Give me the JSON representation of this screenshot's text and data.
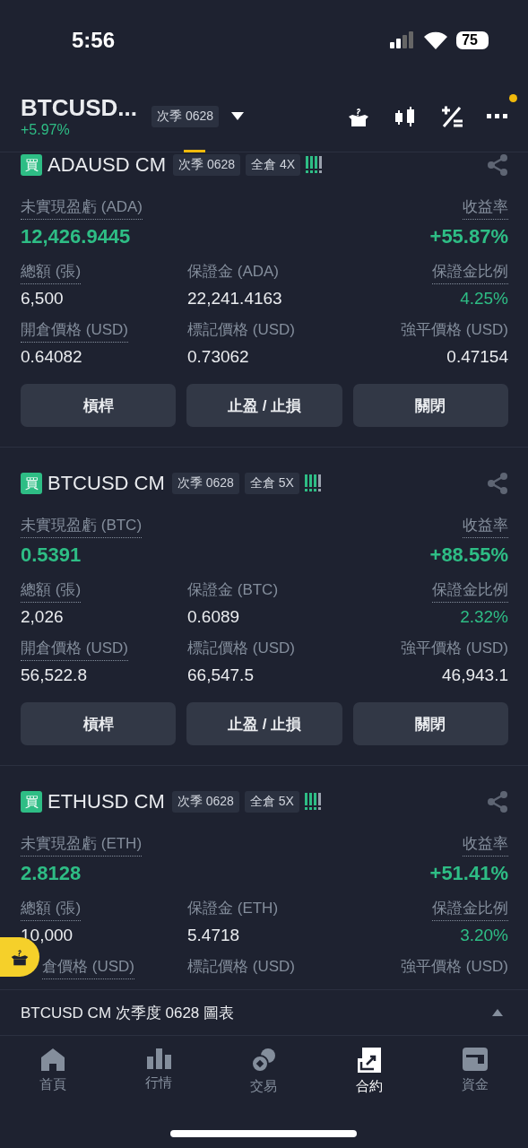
{
  "status_bar": {
    "time": "5:56",
    "battery": "75"
  },
  "header": {
    "symbol": "BTCUSD...",
    "change": "+5.97%",
    "contract": "次季 0628",
    "has_notification": true
  },
  "positions": [
    {
      "side": "買",
      "symbol": "ADAUSD CM",
      "contract": "次季 0628",
      "margin_mode": "全倉 4X",
      "pnl_label": "未實現盈虧 (ADA)",
      "pnl_value": "12,426.9445",
      "roe_label": "收益率",
      "roe_value": "+55.87%",
      "stats": [
        {
          "label": "總額 (張)",
          "value": "6,500",
          "underlined": true,
          "highlighted": false
        },
        {
          "label": "保證金 (ADA)",
          "value": "22,241.4163",
          "underlined": false,
          "highlighted": false
        },
        {
          "label": "保證金比例",
          "value": "4.25%",
          "underlined": true,
          "highlighted": true
        },
        {
          "label": "開倉價格 (USD)",
          "value": "0.64082",
          "underlined": true,
          "highlighted": false
        },
        {
          "label": "標記價格 (USD)",
          "value": "0.73062",
          "underlined": false,
          "highlighted": false
        },
        {
          "label": "強平價格 (USD)",
          "value": "0.47154",
          "underlined": false,
          "highlighted": false
        }
      ],
      "actions": [
        "槓桿",
        "止盈 / 止損",
        "關閉"
      ]
    },
    {
      "side": "買",
      "symbol": "BTCUSD CM",
      "contract": "次季 0628",
      "margin_mode": "全倉 5X",
      "pnl_label": "未實現盈虧 (BTC)",
      "pnl_value": "0.5391",
      "roe_label": "收益率",
      "roe_value": "+88.55%",
      "stats": [
        {
          "label": "總額 (張)",
          "value": "2,026",
          "underlined": true,
          "highlighted": false
        },
        {
          "label": "保證金 (BTC)",
          "value": "0.6089",
          "underlined": false,
          "highlighted": false
        },
        {
          "label": "保證金比例",
          "value": "2.32%",
          "underlined": true,
          "highlighted": true
        },
        {
          "label": "開倉價格 (USD)",
          "value": "56,522.8",
          "underlined": true,
          "highlighted": false
        },
        {
          "label": "標記價格 (USD)",
          "value": "66,547.5",
          "underlined": false,
          "highlighted": false
        },
        {
          "label": "強平價格 (USD)",
          "value": "46,943.1",
          "underlined": false,
          "highlighted": false
        }
      ],
      "actions": [
        "槓桿",
        "止盈 / 止損",
        "關閉"
      ]
    },
    {
      "side": "買",
      "symbol": "ETHUSD CM",
      "contract": "次季 0628",
      "margin_mode": "全倉 5X",
      "pnl_label": "未實現盈虧 (ETH)",
      "pnl_value": "2.8128",
      "roe_label": "收益率",
      "roe_value": "+51.41%",
      "stats": [
        {
          "label": "總額 (張)",
          "value": "10,000",
          "underlined": true,
          "highlighted": false
        },
        {
          "label": "保證金 (ETH)",
          "value": "5.4718",
          "underlined": false,
          "highlighted": false
        },
        {
          "label": "保證金比例",
          "value": "3.20%",
          "underlined": true,
          "highlighted": true
        },
        {
          "label": "倉價格 (USD)",
          "underlined": true
        },
        {
          "label": "標記價格 (USD)",
          "underlined": false
        },
        {
          "label": "強平價格 (USD)",
          "underlined": false
        }
      ]
    }
  ],
  "chart_bar": {
    "title": "BTCUSD CM 次季度 0628 圖表"
  },
  "nav": [
    {
      "label": "首頁",
      "selected": false
    },
    {
      "label": "行情",
      "selected": false
    },
    {
      "label": "交易",
      "selected": false
    },
    {
      "label": "合約",
      "selected": true
    },
    {
      "label": "資金",
      "selected": false
    }
  ]
}
